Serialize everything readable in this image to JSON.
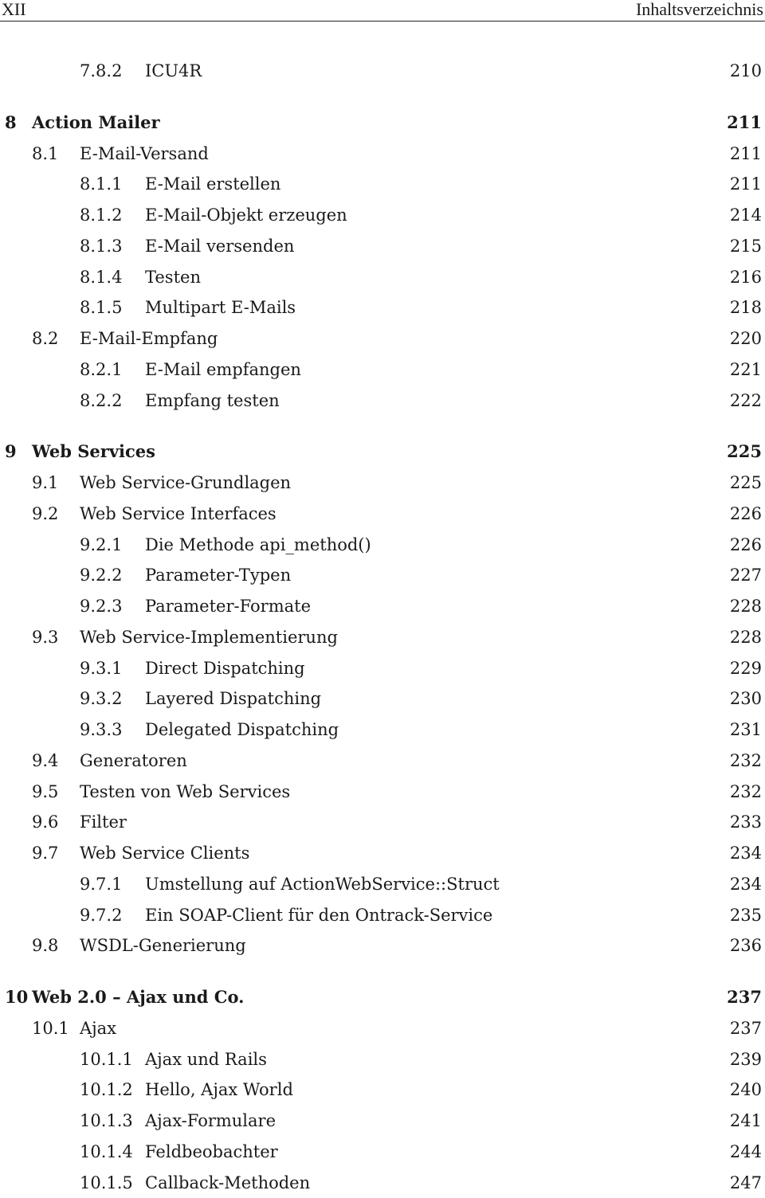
{
  "header": {
    "page_number": "XII",
    "section_title": "Inhaltsverzeichnis"
  },
  "toc": [
    {
      "level": 2,
      "num": "7.8.2",
      "title": "ICU4R",
      "page": "210"
    },
    {
      "level": 0,
      "num": "8",
      "title": "Action Mailer",
      "page": "211",
      "gap_before": true
    },
    {
      "level": 1,
      "num": "8.1",
      "title": "E-Mail-Versand",
      "page": "211"
    },
    {
      "level": 2,
      "num": "8.1.1",
      "title": "E-Mail erstellen",
      "page": "211"
    },
    {
      "level": 2,
      "num": "8.1.2",
      "title": "E-Mail-Objekt erzeugen",
      "page": "214"
    },
    {
      "level": 2,
      "num": "8.1.3",
      "title": "E-Mail versenden",
      "page": "215"
    },
    {
      "level": 2,
      "num": "8.1.4",
      "title": "Testen",
      "page": "216"
    },
    {
      "level": 2,
      "num": "8.1.5",
      "title": "Multipart E-Mails",
      "page": "218"
    },
    {
      "level": 1,
      "num": "8.2",
      "title": "E-Mail-Empfang",
      "page": "220"
    },
    {
      "level": 2,
      "num": "8.2.1",
      "title": "E-Mail empfangen",
      "page": "221"
    },
    {
      "level": 2,
      "num": "8.2.2",
      "title": "Empfang testen",
      "page": "222"
    },
    {
      "level": 0,
      "num": "9",
      "title": "Web Services",
      "page": "225",
      "gap_before": true
    },
    {
      "level": 1,
      "num": "9.1",
      "title": "Web Service-Grundlagen",
      "page": "225"
    },
    {
      "level": 1,
      "num": "9.2",
      "title": "Web Service Interfaces",
      "page": "226"
    },
    {
      "level": 2,
      "num": "9.2.1",
      "title": "Die Methode api_method()",
      "page": "226"
    },
    {
      "level": 2,
      "num": "9.2.2",
      "title": "Parameter-Typen",
      "page": "227"
    },
    {
      "level": 2,
      "num": "9.2.3",
      "title": "Parameter-Formate",
      "page": "228"
    },
    {
      "level": 1,
      "num": "9.3",
      "title": "Web Service-Implementierung",
      "page": "228"
    },
    {
      "level": 2,
      "num": "9.3.1",
      "title": "Direct Dispatching",
      "page": "229"
    },
    {
      "level": 2,
      "num": "9.3.2",
      "title": "Layered Dispatching",
      "page": "230"
    },
    {
      "level": 2,
      "num": "9.3.3",
      "title": "Delegated Dispatching",
      "page": "231"
    },
    {
      "level": 1,
      "num": "9.4",
      "title": "Generatoren",
      "page": "232"
    },
    {
      "level": 1,
      "num": "9.5",
      "title": "Testen von Web Services",
      "page": "232"
    },
    {
      "level": 1,
      "num": "9.6",
      "title": "Filter",
      "page": "233"
    },
    {
      "level": 1,
      "num": "9.7",
      "title": "Web Service Clients",
      "page": "234"
    },
    {
      "level": 2,
      "num": "9.7.1",
      "title": "Umstellung auf ActionWebService::Struct",
      "page": "234"
    },
    {
      "level": 2,
      "num": "9.7.2",
      "title": "Ein SOAP-Client für den Ontrack-Service",
      "page": "235"
    },
    {
      "level": 1,
      "num": "9.8",
      "title": "WSDL-Generierung",
      "page": "236"
    },
    {
      "level": 0,
      "num": "10",
      "title": "Web 2.0 – Ajax und Co.",
      "page": "237",
      "gap_before": true
    },
    {
      "level": 1,
      "num": "10.1",
      "title": "Ajax",
      "page": "237"
    },
    {
      "level": 2,
      "num": "10.1.1",
      "title": "Ajax und Rails",
      "page": "239"
    },
    {
      "level": 2,
      "num": "10.1.2",
      "title": "Hello, Ajax World",
      "page": "240"
    },
    {
      "level": 2,
      "num": "10.1.3",
      "title": "Ajax-Formulare",
      "page": "241"
    },
    {
      "level": 2,
      "num": "10.1.4",
      "title": "Feldbeobachter",
      "page": "244"
    },
    {
      "level": 2,
      "num": "10.1.5",
      "title": "Callback-Methoden",
      "page": "247"
    }
  ]
}
